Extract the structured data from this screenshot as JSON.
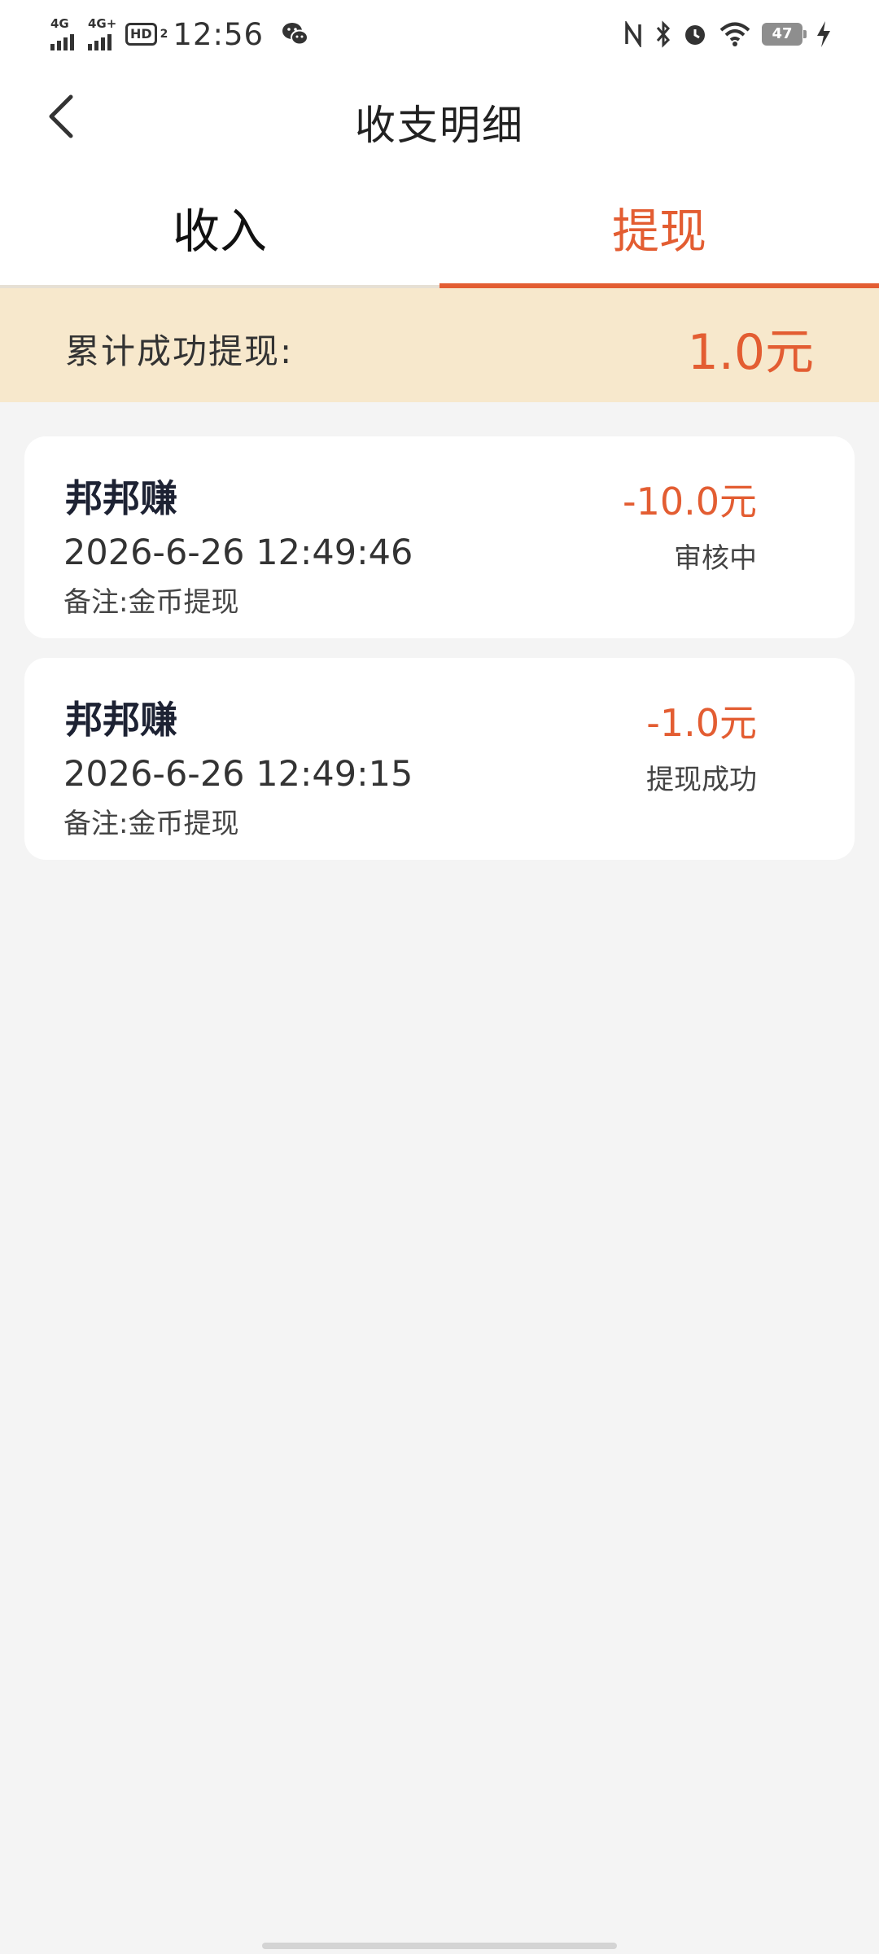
{
  "status_bar": {
    "signal1_label": "4G",
    "signal2_label": "4G+",
    "hd_label": "HD",
    "hd_sub": "2",
    "time": "12:56",
    "battery_level": "47",
    "icons": [
      "nfc-icon",
      "bluetooth-icon",
      "alarm-icon",
      "wifi-icon",
      "battery-icon",
      "charging-icon"
    ]
  },
  "header": {
    "title": "收支明细",
    "back_icon": "chevron-left-icon"
  },
  "tabs": [
    {
      "label": "收入",
      "active": false
    },
    {
      "label": "提现",
      "active": true
    }
  ],
  "summary": {
    "label": "累计成功提现:",
    "value": "1.0元"
  },
  "records": [
    {
      "name": "邦邦赚",
      "time": "2026-6-26 12:49:46",
      "note": "备注:金币提现",
      "amount": "-10.0元",
      "status": "审核中"
    },
    {
      "name": "邦邦赚",
      "time": "2026-6-26 12:49:15",
      "note": "备注:金币提现",
      "amount": "-1.0元",
      "status": "提现成功"
    }
  ],
  "colors": {
    "accent": "#e35d32",
    "summary_bg": "#f7e8cc",
    "page_bg": "#f4f4f4"
  }
}
